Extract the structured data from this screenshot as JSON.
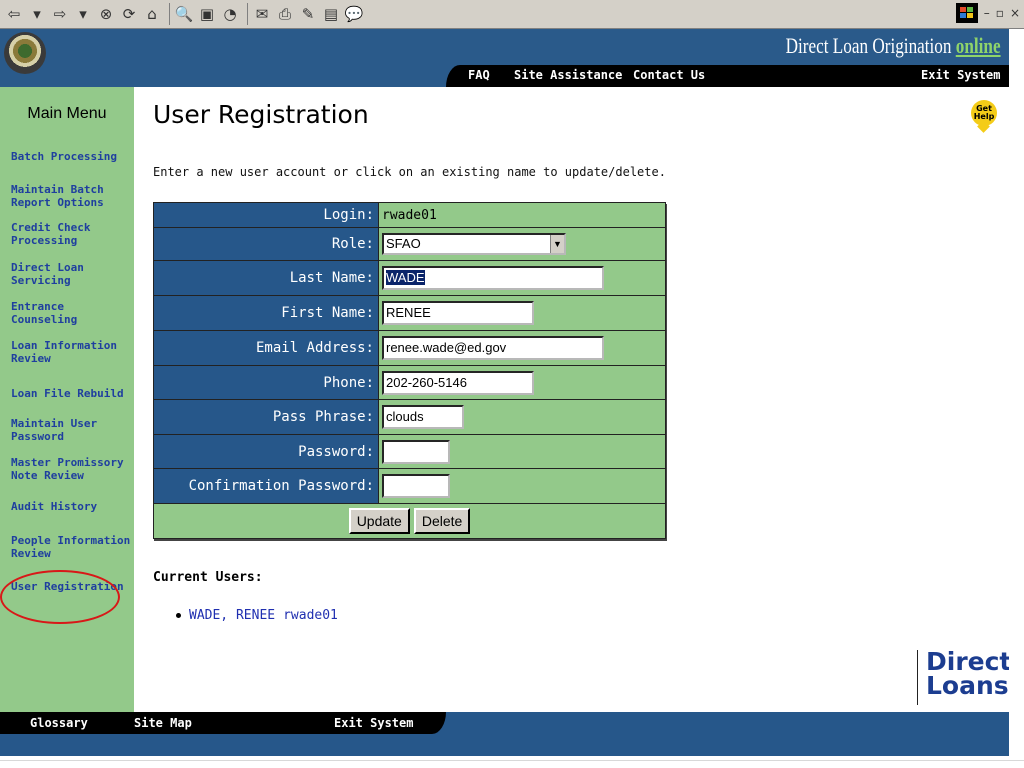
{
  "browser": {
    "tb_back": "⇦",
    "tb_back_drop": "▾",
    "tb_fwd": "⇨",
    "tb_fwd_drop": "▾",
    "tb_stop": "⊗",
    "tb_refresh": "⟳",
    "tb_home": "⌂",
    "tb_search": "🔍",
    "tb_favorites": "▣",
    "tb_history": "◔",
    "tb_mail": "✉",
    "tb_print": "⎙",
    "tb_edit": "✎",
    "tb_doc": "▤",
    "tb_discuss": "💬",
    "win_min": "–",
    "win_max": "▫",
    "win_close": "×"
  },
  "header": {
    "brand_title": "Direct Loan Origination",
    "brand_online": "online",
    "nav": {
      "faq": "FAQ",
      "site_assistance": "Site Assistance",
      "contact_us": "Contact Us",
      "exit_system": "Exit System"
    }
  },
  "sidebar": {
    "title": "Main Menu",
    "items": [
      {
        "l1": "Batch Processing",
        "l2": ""
      },
      {
        "l1": "Maintain Batch",
        "l2": "Report Options"
      },
      {
        "l1": "Credit Check",
        "l2": "Processing"
      },
      {
        "l1": "Direct Loan",
        "l2": "Servicing"
      },
      {
        "l1": "Entrance",
        "l2": "Counseling"
      },
      {
        "l1": "Loan Information",
        "l2": "Review"
      },
      {
        "l1": "Loan File Rebuild",
        "l2": ""
      },
      {
        "l1": "Maintain User",
        "l2": "Password"
      },
      {
        "l1": "Master Promissory",
        "l2": "Note Review"
      },
      {
        "l1": "Audit History",
        "l2": ""
      },
      {
        "l1": "People Information",
        "l2": "Review"
      },
      {
        "l1": "User Registration",
        "l2": ""
      }
    ]
  },
  "page": {
    "title": "User Registration",
    "help_line1": "Get",
    "help_line2": "Help",
    "intro": "Enter a new user account or click on an existing name to update/delete."
  },
  "form": {
    "login_label": "Login:",
    "login_value": "rwade01",
    "role_label": "Role:",
    "role_value": "SFAO",
    "role_arrow": "▼",
    "last_name_label": "Last Name:",
    "last_name_value": "WADE",
    "first_name_label": "First Name:",
    "first_name_value": "RENEE",
    "email_label": "Email Address:",
    "email_value": "renee.wade@ed.gov",
    "phone_label": "Phone:",
    "phone_value": "202-260-5146",
    "pass_phrase_label": "Pass Phrase:",
    "pass_phrase_value": "clouds",
    "password_label": "Password:",
    "password_value": "",
    "confirm_label": "Confirmation Password:",
    "confirm_value": "",
    "update_button": "Update",
    "delete_button": "Delete"
  },
  "current_users": {
    "heading": "Current Users:",
    "users": [
      {
        "name": "WADE, RENEE",
        "login": "rwade01"
      }
    ]
  },
  "logo": {
    "line1": "Direct",
    "line2": "Loans"
  },
  "footer": {
    "glossary": "Glossary",
    "site_map": "Site Map",
    "exit_system": "Exit System"
  },
  "colors": {
    "navy": "#26578a",
    "sidebar_green": "#93c98a",
    "link_blue": "#1f3f9f",
    "highlight_red": "#d81818"
  }
}
